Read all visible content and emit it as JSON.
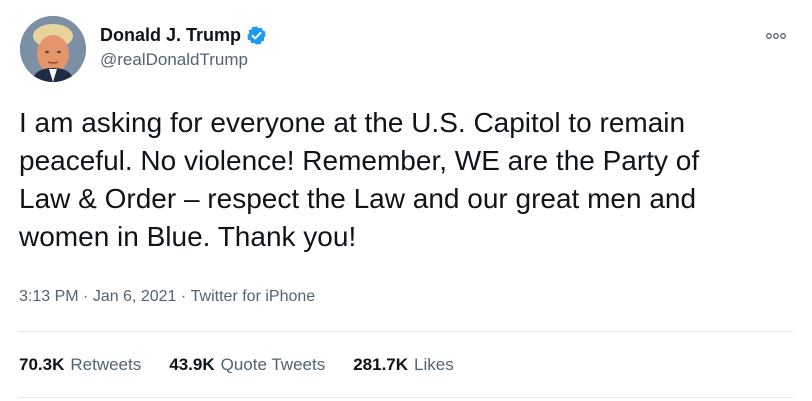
{
  "author": {
    "display_name": "Donald J. Trump",
    "handle": "@realDonaldTrump",
    "verified_icon": "verified-badge",
    "avatar": "profile-photo"
  },
  "menu_icon": "more-options-icon",
  "tweet": {
    "text": "I am asking for everyone at the U.S. Capitol to remain\npeaceful. No violence! Remember, WE are the Party of\nLaw & Order – respect the Law and our great men and\nwomen in Blue. Thank you!"
  },
  "meta": {
    "time": "3:13 PM",
    "sep1": " · ",
    "date": "Jan 6, 2021",
    "sep2": " · ",
    "source": "Twitter for iPhone"
  },
  "stats": {
    "retweets": {
      "count": "70.3K",
      "label": "Retweets"
    },
    "quote_tweets": {
      "count": "43.9K",
      "label": "Quote Tweets"
    },
    "likes": {
      "count": "281.7K",
      "label": "Likes"
    }
  },
  "colors": {
    "verified": "#1d9bf0",
    "secondary_text": "#536471",
    "primary_text": "#0f1419",
    "divider": "#e1e8ed"
  }
}
